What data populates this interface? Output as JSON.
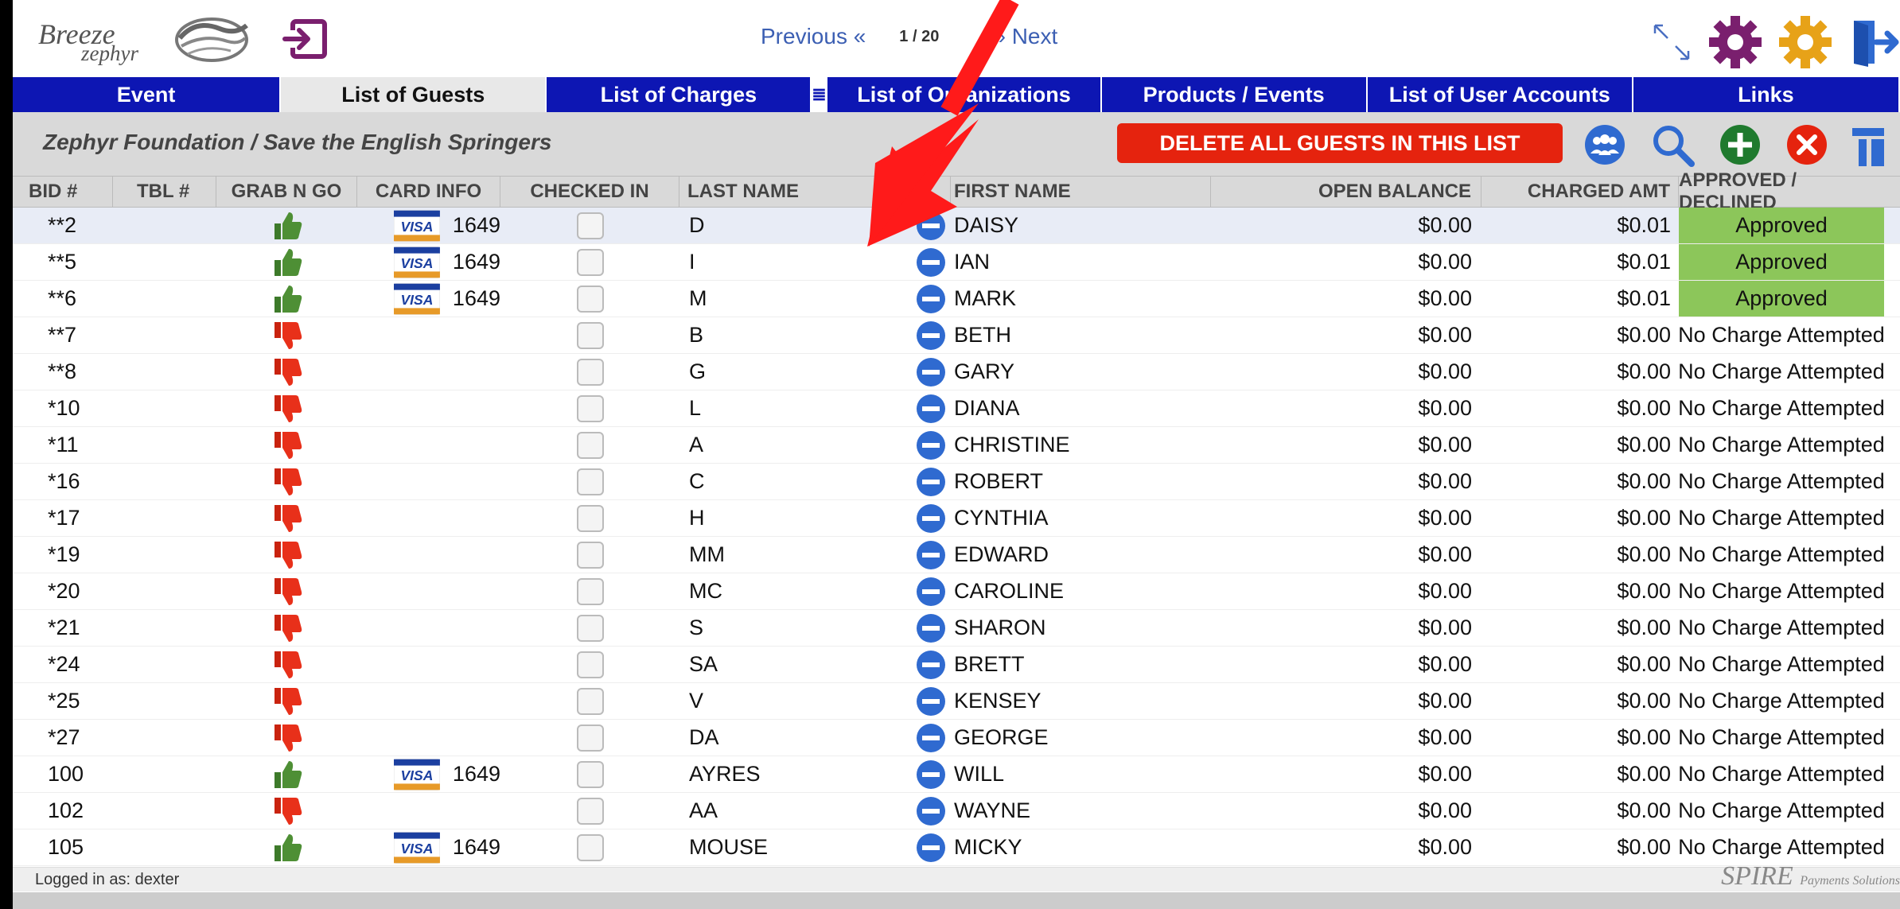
{
  "logo": {
    "brand": "Breeze",
    "sub": "zephyr"
  },
  "pager": {
    "previous": "Previous",
    "position": "1 / 20",
    "next": "Next"
  },
  "colors": {
    "nav": "#0d16b3",
    "approved": "#8cc65a",
    "delete": "#e5230e",
    "accent": "#7a1f6e",
    "gold": "#e7a218"
  },
  "nav": {
    "tabs": [
      {
        "label": "Event"
      },
      {
        "label": "List of Guests"
      },
      {
        "label": "List of Charges"
      },
      {
        "label": "List of Organizations"
      },
      {
        "label": "Products / Events"
      },
      {
        "label": "List of User Accounts"
      },
      {
        "label": "Links"
      }
    ],
    "menu_glyph": "≣"
  },
  "subheader": {
    "title": "Zephyr Foundation / Save the English Springers",
    "delete_label": "DELETE ALL GUESTS IN THIS LIST"
  },
  "table": {
    "headers": [
      "BID #",
      "TBL #",
      "GRAB N GO",
      "CARD INFO",
      "CHECKED IN",
      "LAST NAME",
      "FIRST NAME",
      "OPEN BALANCE",
      "CHARGED AMT",
      "APPROVED / DECLINED"
    ],
    "rows": [
      {
        "bid": "**2",
        "tbl": "",
        "grab": "up",
        "card": "1649",
        "last": "D",
        "first": "DAISY",
        "open": "$0.00",
        "charged": "$0.01",
        "status": "Approved"
      },
      {
        "bid": "**5",
        "tbl": "",
        "grab": "up",
        "card": "1649",
        "last": "I",
        "first": "IAN",
        "open": "$0.00",
        "charged": "$0.01",
        "status": "Approved"
      },
      {
        "bid": "**6",
        "tbl": "",
        "grab": "up",
        "card": "1649",
        "last": "M",
        "first": "MARK",
        "open": "$0.00",
        "charged": "$0.01",
        "status": "Approved"
      },
      {
        "bid": "**7",
        "tbl": "",
        "grab": "down",
        "card": "",
        "last": "B",
        "first": "BETH",
        "open": "$0.00",
        "charged": "$0.00",
        "status": "No Charge Attempted"
      },
      {
        "bid": "**8",
        "tbl": "",
        "grab": "down",
        "card": "",
        "last": "G",
        "first": "GARY",
        "open": "$0.00",
        "charged": "$0.00",
        "status": "No Charge Attempted"
      },
      {
        "bid": "*10",
        "tbl": "",
        "grab": "down",
        "card": "",
        "last": "L",
        "first": "DIANA",
        "open": "$0.00",
        "charged": "$0.00",
        "status": "No Charge Attempted"
      },
      {
        "bid": "*11",
        "tbl": "",
        "grab": "down",
        "card": "",
        "last": "A",
        "first": "CHRISTINE",
        "open": "$0.00",
        "charged": "$0.00",
        "status": "No Charge Attempted"
      },
      {
        "bid": "*16",
        "tbl": "",
        "grab": "down",
        "card": "",
        "last": "C",
        "first": "ROBERT",
        "open": "$0.00",
        "charged": "$0.00",
        "status": "No Charge Attempted"
      },
      {
        "bid": "*17",
        "tbl": "",
        "grab": "down",
        "card": "",
        "last": "H",
        "first": "CYNTHIA",
        "open": "$0.00",
        "charged": "$0.00",
        "status": "No Charge Attempted"
      },
      {
        "bid": "*19",
        "tbl": "",
        "grab": "down",
        "card": "",
        "last": "MM",
        "first": "EDWARD",
        "open": "$0.00",
        "charged": "$0.00",
        "status": "No Charge Attempted"
      },
      {
        "bid": "*20",
        "tbl": "",
        "grab": "down",
        "card": "",
        "last": "MC",
        "first": "CAROLINE",
        "open": "$0.00",
        "charged": "$0.00",
        "status": "No Charge Attempted"
      },
      {
        "bid": "*21",
        "tbl": "",
        "grab": "down",
        "card": "",
        "last": "S",
        "first": "SHARON",
        "open": "$0.00",
        "charged": "$0.00",
        "status": "No Charge Attempted"
      },
      {
        "bid": "*24",
        "tbl": "",
        "grab": "down",
        "card": "",
        "last": "SA",
        "first": "BRETT",
        "open": "$0.00",
        "charged": "$0.00",
        "status": "No Charge Attempted"
      },
      {
        "bid": "*25",
        "tbl": "",
        "grab": "down",
        "card": "",
        "last": "V",
        "first": "KENSEY",
        "open": "$0.00",
        "charged": "$0.00",
        "status": "No Charge Attempted"
      },
      {
        "bid": "*27",
        "tbl": "",
        "grab": "down",
        "card": "",
        "last": "DA",
        "first": "GEORGE",
        "open": "$0.00",
        "charged": "$0.00",
        "status": "No Charge Attempted"
      },
      {
        "bid": "100",
        "tbl": "",
        "grab": "up",
        "card": "1649",
        "last": "AYRES",
        "first": "WILL",
        "open": "$0.00",
        "charged": "$0.00",
        "status": "No Charge Attempted"
      },
      {
        "bid": "102",
        "tbl": "",
        "grab": "down",
        "card": "",
        "last": "AA",
        "first": "WAYNE",
        "open": "$0.00",
        "charged": "$0.00",
        "status": "No Charge Attempted"
      },
      {
        "bid": "105",
        "tbl": "",
        "grab": "up",
        "card": "1649",
        "last": "MOUSE",
        "first": "MICKY",
        "open": "$0.00",
        "charged": "$0.00",
        "status": "No Charge Attempted"
      }
    ]
  },
  "footer": {
    "logged_in": "Logged in as: dexter",
    "spire": "SPIRE",
    "spire_sub": "Payments Solutions"
  }
}
